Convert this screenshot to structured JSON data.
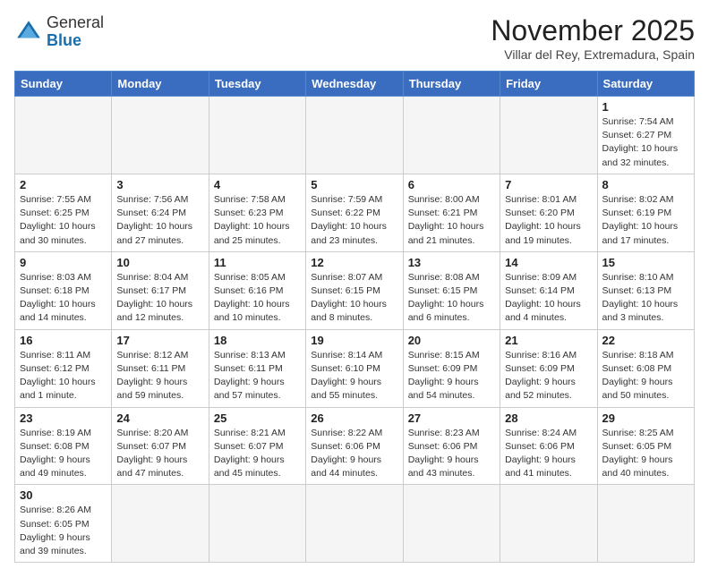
{
  "header": {
    "logo_general": "General",
    "logo_blue": "Blue",
    "title": "November 2025",
    "subtitle": "Villar del Rey, Extremadura, Spain"
  },
  "weekdays": [
    "Sunday",
    "Monday",
    "Tuesday",
    "Wednesday",
    "Thursday",
    "Friday",
    "Saturday"
  ],
  "weeks": [
    [
      {
        "day": "",
        "info": ""
      },
      {
        "day": "",
        "info": ""
      },
      {
        "day": "",
        "info": ""
      },
      {
        "day": "",
        "info": ""
      },
      {
        "day": "",
        "info": ""
      },
      {
        "day": "",
        "info": ""
      },
      {
        "day": "1",
        "info": "Sunrise: 7:54 AM\nSunset: 6:27 PM\nDaylight: 10 hours and 32 minutes."
      }
    ],
    [
      {
        "day": "2",
        "info": "Sunrise: 7:55 AM\nSunset: 6:25 PM\nDaylight: 10 hours and 30 minutes."
      },
      {
        "day": "3",
        "info": "Sunrise: 7:56 AM\nSunset: 6:24 PM\nDaylight: 10 hours and 27 minutes."
      },
      {
        "day": "4",
        "info": "Sunrise: 7:58 AM\nSunset: 6:23 PM\nDaylight: 10 hours and 25 minutes."
      },
      {
        "day": "5",
        "info": "Sunrise: 7:59 AM\nSunset: 6:22 PM\nDaylight: 10 hours and 23 minutes."
      },
      {
        "day": "6",
        "info": "Sunrise: 8:00 AM\nSunset: 6:21 PM\nDaylight: 10 hours and 21 minutes."
      },
      {
        "day": "7",
        "info": "Sunrise: 8:01 AM\nSunset: 6:20 PM\nDaylight: 10 hours and 19 minutes."
      },
      {
        "day": "8",
        "info": "Sunrise: 8:02 AM\nSunset: 6:19 PM\nDaylight: 10 hours and 17 minutes."
      }
    ],
    [
      {
        "day": "9",
        "info": "Sunrise: 8:03 AM\nSunset: 6:18 PM\nDaylight: 10 hours and 14 minutes."
      },
      {
        "day": "10",
        "info": "Sunrise: 8:04 AM\nSunset: 6:17 PM\nDaylight: 10 hours and 12 minutes."
      },
      {
        "day": "11",
        "info": "Sunrise: 8:05 AM\nSunset: 6:16 PM\nDaylight: 10 hours and 10 minutes."
      },
      {
        "day": "12",
        "info": "Sunrise: 8:07 AM\nSunset: 6:15 PM\nDaylight: 10 hours and 8 minutes."
      },
      {
        "day": "13",
        "info": "Sunrise: 8:08 AM\nSunset: 6:15 PM\nDaylight: 10 hours and 6 minutes."
      },
      {
        "day": "14",
        "info": "Sunrise: 8:09 AM\nSunset: 6:14 PM\nDaylight: 10 hours and 4 minutes."
      },
      {
        "day": "15",
        "info": "Sunrise: 8:10 AM\nSunset: 6:13 PM\nDaylight: 10 hours and 3 minutes."
      }
    ],
    [
      {
        "day": "16",
        "info": "Sunrise: 8:11 AM\nSunset: 6:12 PM\nDaylight: 10 hours and 1 minute."
      },
      {
        "day": "17",
        "info": "Sunrise: 8:12 AM\nSunset: 6:11 PM\nDaylight: 9 hours and 59 minutes."
      },
      {
        "day": "18",
        "info": "Sunrise: 8:13 AM\nSunset: 6:11 PM\nDaylight: 9 hours and 57 minutes."
      },
      {
        "day": "19",
        "info": "Sunrise: 8:14 AM\nSunset: 6:10 PM\nDaylight: 9 hours and 55 minutes."
      },
      {
        "day": "20",
        "info": "Sunrise: 8:15 AM\nSunset: 6:09 PM\nDaylight: 9 hours and 54 minutes."
      },
      {
        "day": "21",
        "info": "Sunrise: 8:16 AM\nSunset: 6:09 PM\nDaylight: 9 hours and 52 minutes."
      },
      {
        "day": "22",
        "info": "Sunrise: 8:18 AM\nSunset: 6:08 PM\nDaylight: 9 hours and 50 minutes."
      }
    ],
    [
      {
        "day": "23",
        "info": "Sunrise: 8:19 AM\nSunset: 6:08 PM\nDaylight: 9 hours and 49 minutes."
      },
      {
        "day": "24",
        "info": "Sunrise: 8:20 AM\nSunset: 6:07 PM\nDaylight: 9 hours and 47 minutes."
      },
      {
        "day": "25",
        "info": "Sunrise: 8:21 AM\nSunset: 6:07 PM\nDaylight: 9 hours and 45 minutes."
      },
      {
        "day": "26",
        "info": "Sunrise: 8:22 AM\nSunset: 6:06 PM\nDaylight: 9 hours and 44 minutes."
      },
      {
        "day": "27",
        "info": "Sunrise: 8:23 AM\nSunset: 6:06 PM\nDaylight: 9 hours and 43 minutes."
      },
      {
        "day": "28",
        "info": "Sunrise: 8:24 AM\nSunset: 6:06 PM\nDaylight: 9 hours and 41 minutes."
      },
      {
        "day": "29",
        "info": "Sunrise: 8:25 AM\nSunset: 6:05 PM\nDaylight: 9 hours and 40 minutes."
      }
    ],
    [
      {
        "day": "30",
        "info": "Sunrise: 8:26 AM\nSunset: 6:05 PM\nDaylight: 9 hours and 39 minutes."
      },
      {
        "day": "",
        "info": ""
      },
      {
        "day": "",
        "info": ""
      },
      {
        "day": "",
        "info": ""
      },
      {
        "day": "",
        "info": ""
      },
      {
        "day": "",
        "info": ""
      },
      {
        "day": "",
        "info": ""
      }
    ]
  ]
}
